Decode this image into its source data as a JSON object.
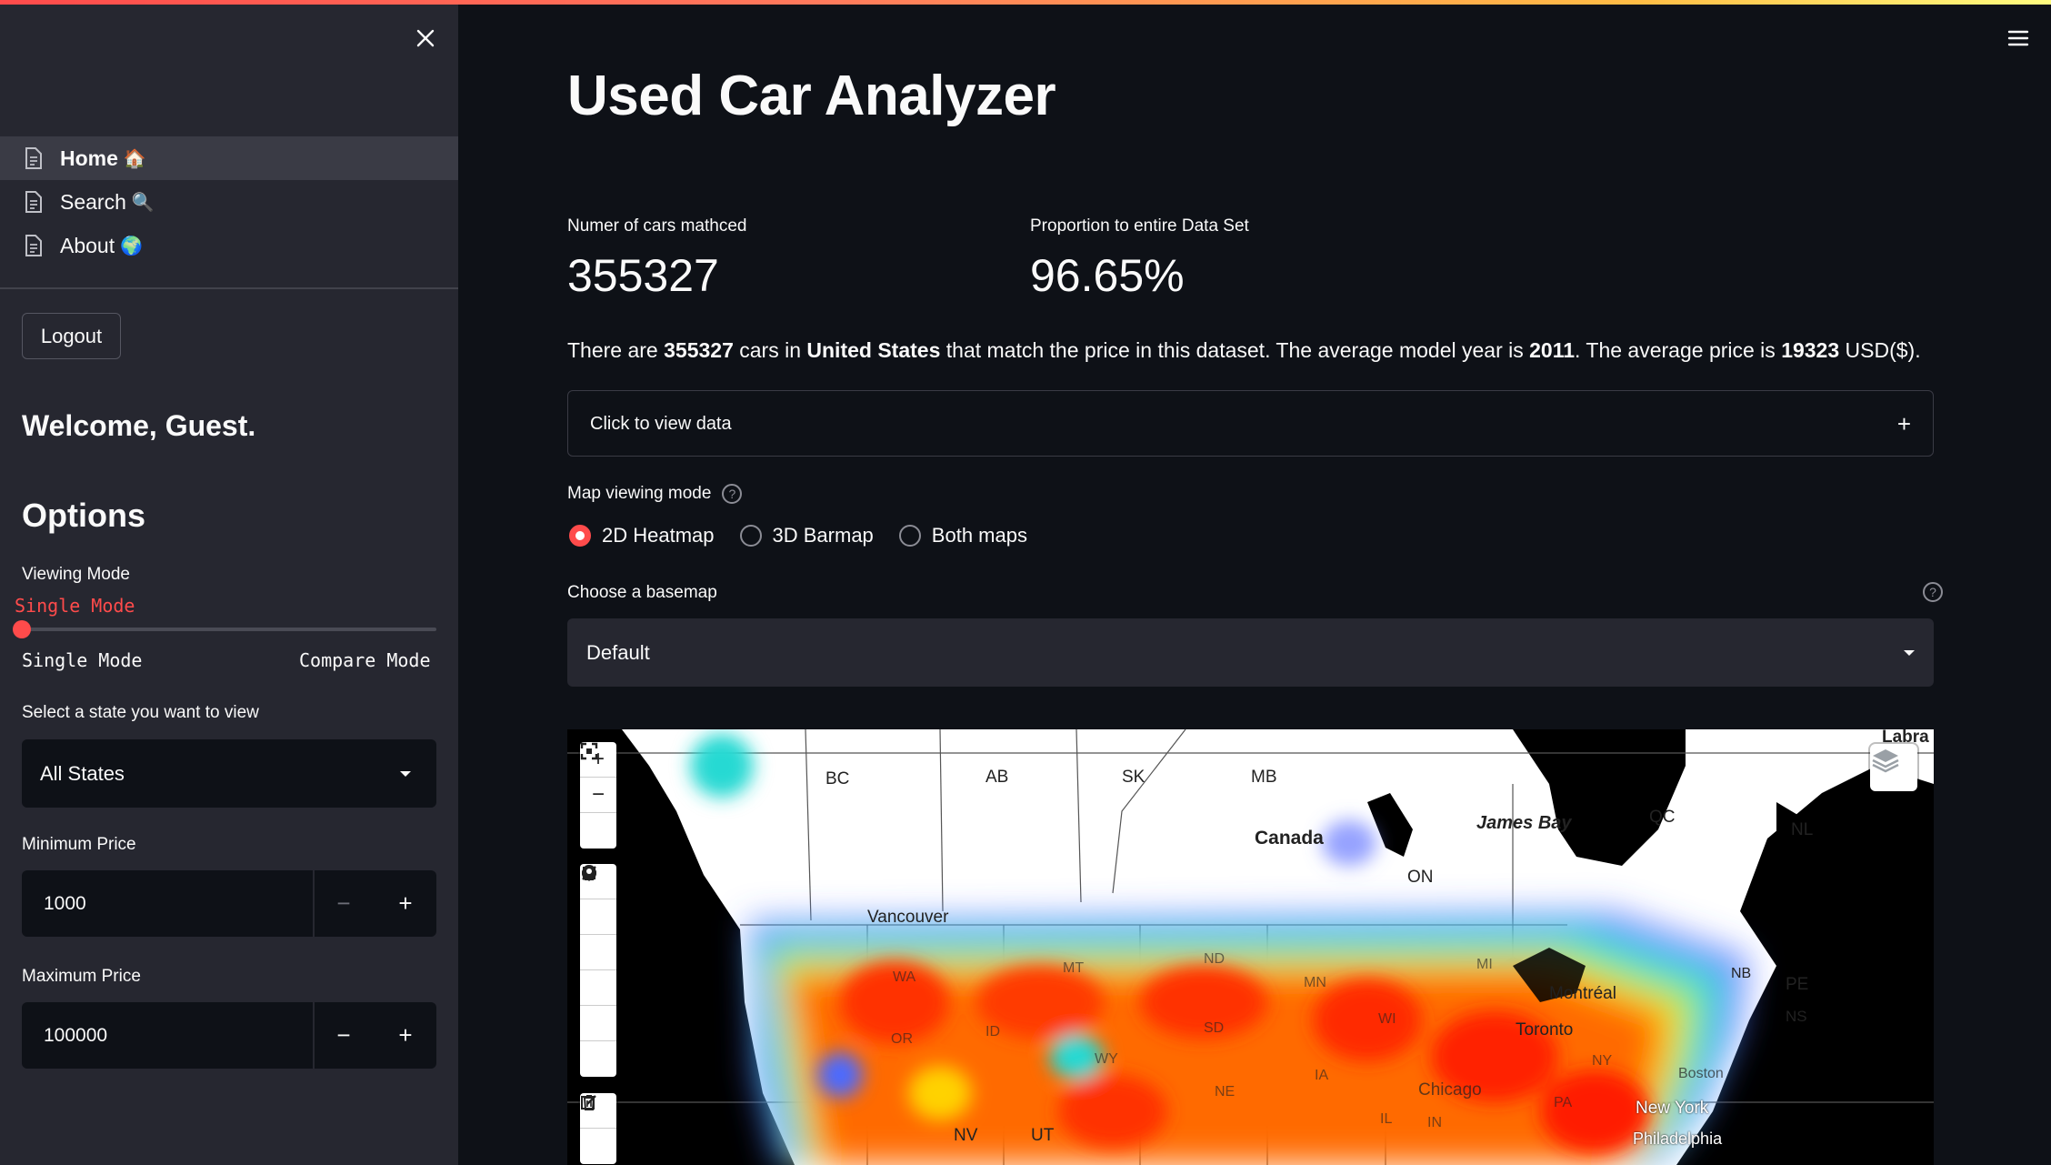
{
  "sidebar": {
    "nav": [
      {
        "label": "Home",
        "emoji": "🏠"
      },
      {
        "label": "Search",
        "emoji": "🔍"
      },
      {
        "label": "About",
        "emoji": "🌍"
      }
    ],
    "logout_label": "Logout",
    "welcome": "Welcome, Guest.",
    "options_heading": "Options",
    "viewing_mode": {
      "label": "Viewing Mode",
      "value": "Single Mode",
      "min_label": "Single Mode",
      "max_label": "Compare Mode",
      "position": 0
    },
    "state": {
      "label": "Select a state you want to view",
      "value": "All States"
    },
    "min_price": {
      "label": "Minimum Price",
      "value": "1000"
    },
    "max_price": {
      "label": "Maximum Price",
      "value": "100000"
    },
    "minus": "−",
    "plus": "+"
  },
  "main": {
    "title": "Used Car Analyzer",
    "metric1": {
      "label": "Numer of cars mathced",
      "value": "355327"
    },
    "metric2": {
      "label": "Proportion to entire Data Set",
      "value": "96.65%"
    },
    "summary": {
      "t1": "There are ",
      "count": "355327",
      "t2": " cars in ",
      "region": "United States",
      "t3": " that match the price in this dataset. The average model year is ",
      "year": "2011",
      "t4": ". The average price is ",
      "price": "19323",
      "t5": " USD($)."
    },
    "expander": {
      "label": "Click to view data",
      "icon": "+"
    },
    "map_mode": {
      "label": "Map viewing mode",
      "options": [
        "2D Heatmap",
        "3D Barmap",
        "Both maps"
      ],
      "selected": "2D Heatmap"
    },
    "basemap": {
      "label": "Choose a basemap",
      "value": "Default"
    },
    "help_glyph": "?"
  },
  "map": {
    "labels": [
      "BC",
      "AB",
      "SK",
      "MB",
      "Canada",
      "James Bay",
      "QC",
      "NL",
      "Labra",
      "ON",
      "Vancouver",
      "Montréal",
      "Toronto",
      "NB",
      "PE",
      "NS",
      "ND",
      "MN",
      "SD",
      "MT",
      "WY",
      "ID",
      "OR",
      "WA",
      "NE",
      "IA",
      "WI",
      "MI",
      "NV",
      "UT",
      "IL",
      "IN",
      "PA",
      "NY",
      "Chicago",
      "New York",
      "Philadelphia",
      "Boston"
    ],
    "controls": [
      "+",
      "−"
    ]
  },
  "colors": {
    "accent": "#ff4b4b",
    "sidebar_bg": "#262730",
    "main_bg": "#0e1117"
  }
}
